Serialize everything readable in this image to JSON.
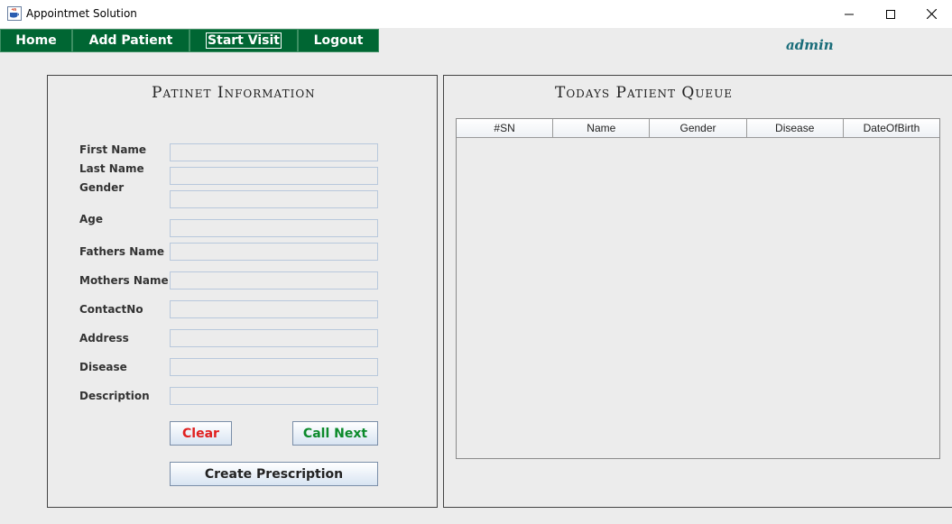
{
  "window": {
    "title": "Appointmet Solution",
    "icon": "java-cup-icon"
  },
  "nav": {
    "home": "Home",
    "add_patient": "Add Patient",
    "start_visit": "Start Visit",
    "logout": "Logout",
    "color": "#006633"
  },
  "user": {
    "name": "admin"
  },
  "patient_info": {
    "title": "Patinet Information",
    "labels": {
      "first_name": "First Name",
      "last_name": "Last Name",
      "gender": "Gender",
      "age": "Age",
      "fathers_name": "Fathers Name",
      "mothers_name": "Mothers Name",
      "contact_no": "ContactNo",
      "address": "Address",
      "disease": "Disease",
      "description": "Description"
    },
    "values": {
      "first_name": "",
      "last_name": "",
      "gender": "",
      "age": "",
      "fathers_name": "",
      "mothers_name": "",
      "contact_no": "",
      "address": "",
      "disease": "",
      "description": ""
    },
    "buttons": {
      "clear": "Clear",
      "call_next": "Call Next",
      "create_prescription": "Create Prescription"
    }
  },
  "queue": {
    "title": "Todays Patient Queue",
    "columns": [
      "#SN",
      "Name",
      "Gender",
      "Disease",
      "DateOfBirth"
    ],
    "rows": []
  }
}
